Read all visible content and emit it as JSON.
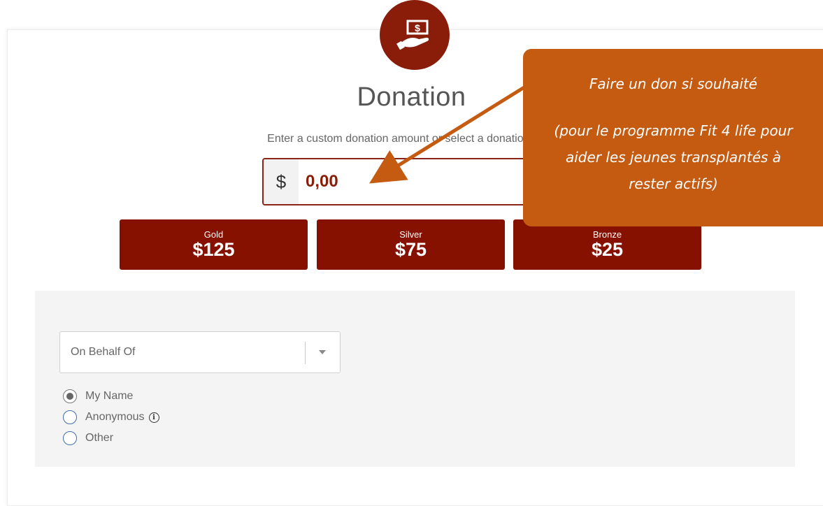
{
  "donation": {
    "title": "Donation",
    "subtitle": "Enter a custom donation amount or select a donation level",
    "currency_symbol": "$",
    "amount_value": "0,00",
    "icon": "donate-hand-money-icon",
    "accent_color": "#861100"
  },
  "tiers": [
    {
      "name": "Gold",
      "amount": "$125"
    },
    {
      "name": "Silver",
      "amount": "$75"
    },
    {
      "name": "Bronze",
      "amount": "$25"
    }
  ],
  "on_behalf": {
    "placeholder": "On Behalf Of",
    "options": [
      {
        "label": "My Name",
        "selected": true
      },
      {
        "label": "Anonymous",
        "selected": false
      },
      {
        "label": "Other",
        "selected": false
      }
    ]
  },
  "callout": {
    "line1": "Faire un don si souhaité",
    "line2": "(pour le programme Fit 4 life pour\naider les jeunes transplantés à\nrester actifs)",
    "color": "#c55a11"
  }
}
